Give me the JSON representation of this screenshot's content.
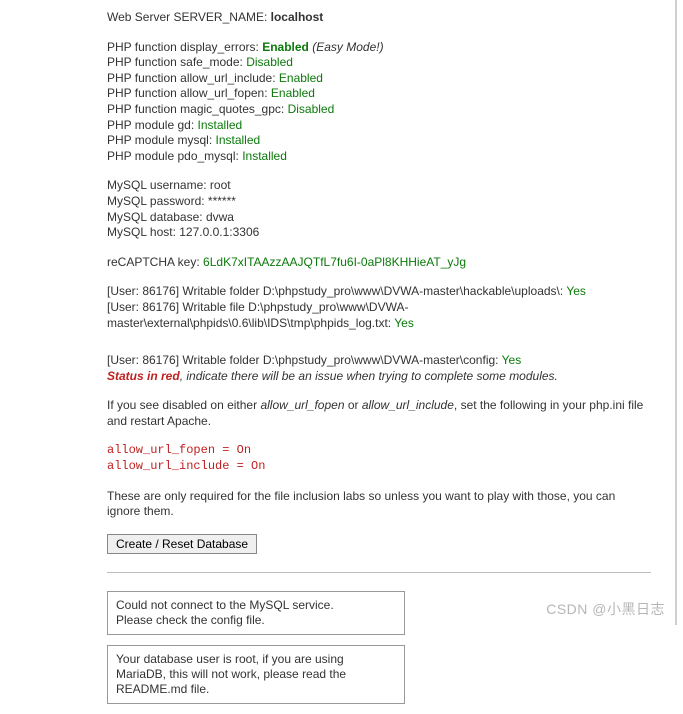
{
  "server": {
    "label": "Web Server SERVER_NAME:",
    "value": "localhost"
  },
  "php_functions": [
    {
      "label": "PHP function display_errors:",
      "status": "Enabled",
      "note": "(Easy Mode!)",
      "note_italic": true
    },
    {
      "label": "PHP function safe_mode:",
      "status": "Disabled"
    },
    {
      "label": "PHP function allow_url_include:",
      "status": "Enabled"
    },
    {
      "label": "PHP function allow_url_fopen:",
      "status": "Enabled"
    },
    {
      "label": "PHP function magic_quotes_gpc:",
      "status": "Disabled"
    },
    {
      "label": "PHP module gd:",
      "status": "Installed"
    },
    {
      "label": "PHP module mysql:",
      "status": "Installed"
    },
    {
      "label": "PHP module pdo_mysql:",
      "status": "Installed"
    }
  ],
  "mysql": {
    "lines": [
      "MySQL username: root",
      "MySQL password: ******",
      "MySQL database: dvwa",
      "MySQL host: 127.0.0.1:3306"
    ]
  },
  "recaptcha": {
    "label": "reCAPTCHA key:",
    "value": "6LdK7xITAAzzAAJQTfL7fu6I-0aPl8KHHieAT_yJg"
  },
  "writable1": {
    "prefix": "[User: 86176] Writable folder D:\\phpstudy_pro\\www\\DVWA-master\\hackable\\uploads\\:",
    "yes": "Yes"
  },
  "writable2": {
    "prefix": "[User: 86176] Writable file D:\\phpstudy_pro\\www\\DVWA-master\\external\\phpids\\0.6\\lib\\IDS\\tmp\\phpids_log.txt:",
    "yes": "Yes"
  },
  "writable3": {
    "prefix": "[User: 86176] Writable folder D:\\phpstudy_pro\\www\\DVWA-master\\config:",
    "yes": "Yes"
  },
  "status_note": {
    "red": "Status in red",
    "rest": ", indicate there will be an issue when trying to complete some modules."
  },
  "disabled_note_a": "If you see disabled on either ",
  "disabled_note_b": "allow_url_fopen",
  "disabled_note_c": " or ",
  "disabled_note_d": "allow_url_include",
  "disabled_note_e": ", set the following in your php.ini file and restart Apache.",
  "code_lines": [
    "allow_url_fopen = On",
    "allow_url_include = On"
  ],
  "only_required": "These are only required for the file inclusion labs so unless you want to play with those, you can ignore them.",
  "button_label": "Create / Reset Database",
  "msg1": "Could not connect to the MySQL service.\nPlease check the config file.",
  "msg2": "Your database user is root, if you are using MariaDB, this will not work, please read the README.md file.",
  "watermark": "CSDN @小黑日志"
}
